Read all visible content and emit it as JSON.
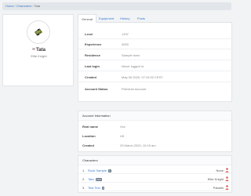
{
  "breadcrumb": {
    "home": "Home",
    "characters": "Characters",
    "current": "Tata",
    "separator": "/"
  },
  "profile": {
    "name": "Tata",
    "vocation": "Elite Knight",
    "flag_icon": "poland-flag-icon",
    "avatar_icon": "knight-sprite-icon"
  },
  "tabs": [
    {
      "label": "General",
      "active": true
    },
    {
      "label": "Equipment",
      "active": false
    },
    {
      "label": "History",
      "active": false
    },
    {
      "label": "Posts",
      "active": false
    }
  ],
  "general": [
    {
      "label": "Level",
      "value": "1337"
    },
    {
      "label": "Experience",
      "value": "4000"
    },
    {
      "label": "Residence",
      "value": "Sample town"
    },
    {
      "label": "Last login",
      "value": "Never logged in."
    },
    {
      "label": "Created",
      "value": "May 06 2020, 07:19:32 CEST"
    },
    {
      "label": "Account Status",
      "value": "Premium Account"
    }
  ],
  "account": {
    "header": "Account Information",
    "rows": [
      {
        "label": "Real name",
        "value": "Xxx"
      },
      {
        "label": "Location",
        "value": "UK"
      },
      {
        "label": "Created",
        "value": "29 March 2020, 10:15 am"
      }
    ]
  },
  "characters": {
    "header": "Characters",
    "items": [
      {
        "index": "1.",
        "name": "Rook Sample",
        "badge": "0",
        "vocation": "None"
      },
      {
        "index": "2.",
        "name": "Tata",
        "badge": "1337",
        "vocation": "Elite Knight"
      },
      {
        "index": "3.",
        "name": "Test Test",
        "badge": "2",
        "vocation": "Paladin"
      }
    ]
  },
  "colors": {
    "link": "#3a7bd5",
    "person_icon": "#d9534f"
  }
}
